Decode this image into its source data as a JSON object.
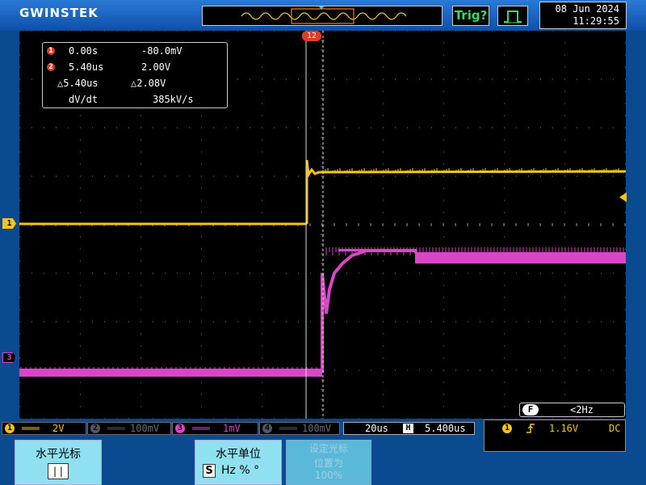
{
  "header": {
    "brand": "GWINSTEK",
    "trigger_label": "Trig?",
    "date": "08 Jun 2024",
    "time": "11:29:55"
  },
  "cursor_readout": {
    "c1_index": "1",
    "c1_time": "0.00s",
    "c1_value": "-80.0mV",
    "c2_index": "2",
    "c2_time": "5.40us",
    "c2_value": "2.00V",
    "delta_time": "△5.40us",
    "delta_value": "△2.08V",
    "rate_label": "dV/dt",
    "rate_value": "385kV/s"
  },
  "markers": {
    "ch1": "1",
    "ch3": "3",
    "cursor_tag": "12"
  },
  "channels": [
    {
      "num": "1",
      "scale": "2V",
      "color": "#f5c518",
      "active": true
    },
    {
      "num": "2",
      "scale": "100mV",
      "color": "#555566",
      "active": false
    },
    {
      "num": "3",
      "scale": "1mV",
      "color": "#d946c8",
      "active": true
    },
    {
      "num": "4",
      "scale": "100mV",
      "color": "#555566",
      "active": false
    }
  ],
  "timebase": {
    "scale": "20us",
    "h_icon": "H",
    "position": "5.400us"
  },
  "trigger": {
    "source": "1",
    "level": "1.16V",
    "coupling": "DC"
  },
  "filter": {
    "icon": "F",
    "value": "<2Hz"
  },
  "softkeys": [
    {
      "title": "水平光标",
      "sub": "| |",
      "enabled": true
    },
    {
      "title": "水平单位",
      "sub_s": "S",
      "sub_rest": "Hz % °",
      "enabled": true
    },
    {
      "title": "设定光标",
      "sub": "位置为",
      "sub2": "100%",
      "enabled": false
    }
  ],
  "colors": {
    "ch1": "#f5c518",
    "ch3": "#d946c8",
    "cursor_accent": "#e03c1f",
    "softkey_bg": "#8fe0f0",
    "trigger_green": "#33dd66"
  }
}
